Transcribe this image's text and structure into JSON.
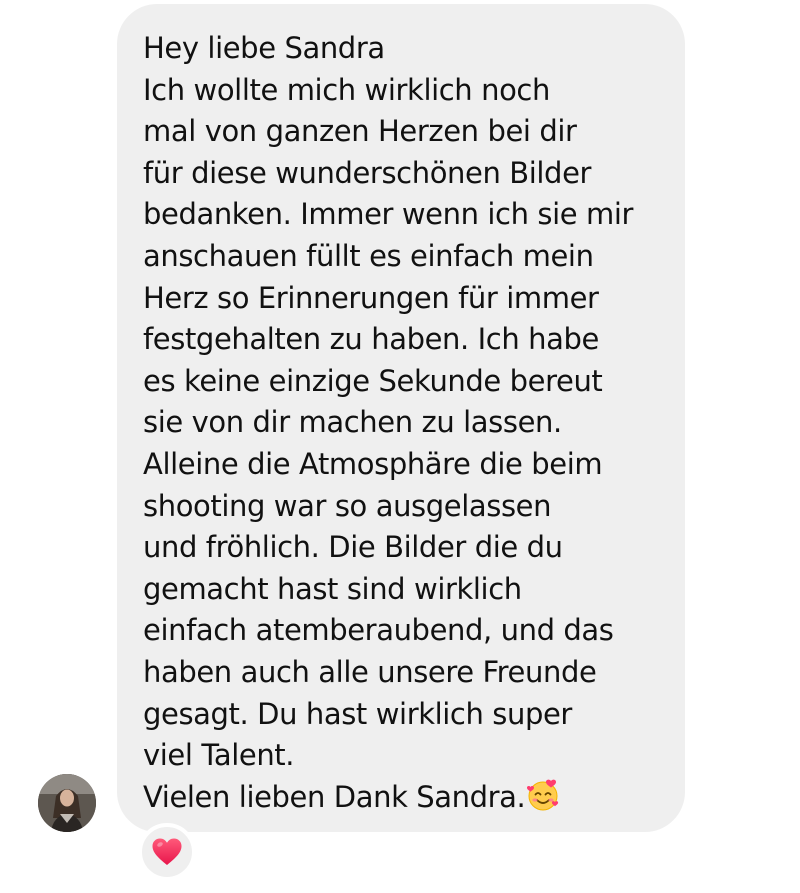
{
  "message": {
    "lines": [
      "Hey liebe Sandra",
      "Ich wollte mich wirklich noch",
      "mal von ganzen Herzen bei dir",
      "für diese wunderschönen Bilder",
      "bedanken. Immer wenn ich sie mir",
      "anschauen füllt es einfach mein",
      "Herz so Erinnerungen für immer",
      "festgehalten zu haben. Ich habe",
      "es keine einzige Sekunde bereut",
      "sie von dir machen zu lassen.",
      "Alleine die Atmosphäre die beim",
      "shooting war so ausgelassen",
      "und fröhlich. Die Bilder die du",
      "gemacht hast sind wirklich",
      "einfach atemberaubend, und das",
      "haben auch alle unsere Freunde",
      "gesagt. Du hast wirklich super",
      "viel Talent.",
      "Vielen lieben Dank Sandra."
    ],
    "emoji": "smiling-face-with-hearts-icon",
    "bubble_color": "#efefef"
  },
  "sender": {
    "avatar": "profile-avatar"
  },
  "reaction": {
    "icon": "red-heart-icon",
    "color": "#ff2d55"
  }
}
